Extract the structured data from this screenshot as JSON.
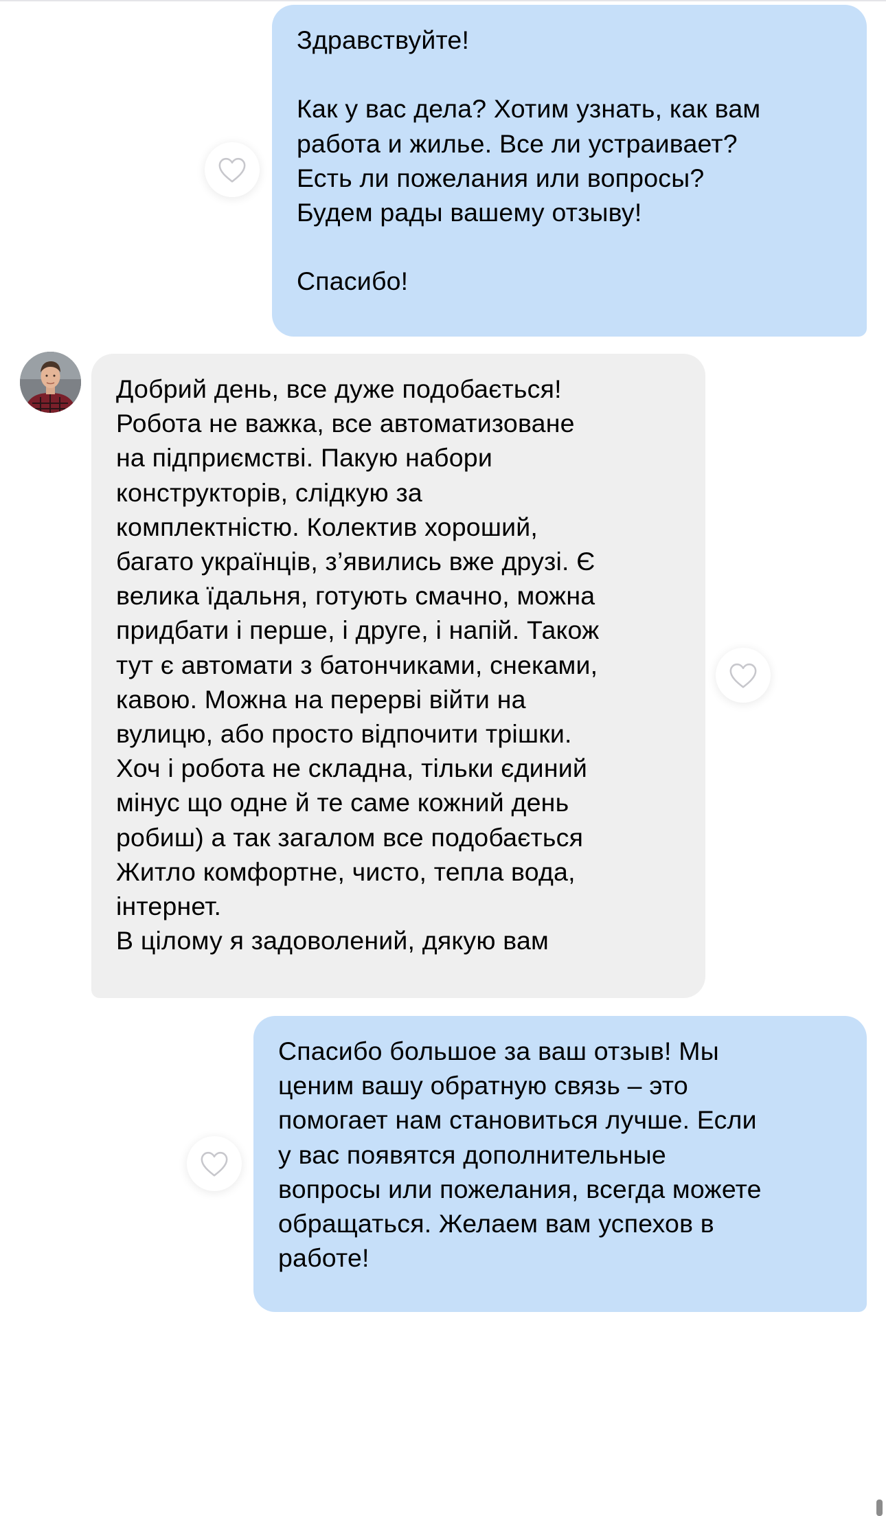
{
  "chat": {
    "messages": [
      {
        "direction": "outgoing",
        "text": "Здравствуйте!\n\nКак у вас дела? Хотим узнать, как вам\nработа и жилье. Все ли устраивает?\nЕсть ли пожелания или вопросы?\nБудем рады вашему отзыву!\n\nСпасибо!",
        "like_icon": "heart-outline-icon"
      },
      {
        "direction": "incoming",
        "avatar": "user-avatar",
        "text": "Добрий день, все дуже подобається!\nРобота не важка, все автоматизоване\nна підприємстві. Пакую набори\nконструкторів, слідкую за\nкомплектністю. Колектив хороший,\nбагато українців, з’явились вже друзі. Є\nвелика їдальня, готують смачно, можна\nпридбати і перше, і друге, і напій. Також\nтут є автомати з батончиками, снеками,\nкавою. Можна на перерві війти на\nвулицю, або просто відпочити трішки.\nХоч і робота не складна, тільки єдиний\nмінус що одне й те саме кожний день\nробиш) а так загалом все подобається\nЖитло комфортне, чисто, тепла вода,\nінтернет.\nВ цілому   я задоволений, дякую вам",
        "like_icon": "heart-outline-icon"
      },
      {
        "direction": "outgoing",
        "text": "Спасибо большое за ваш отзыв! Мы\nценим вашу обратную связь – это\nпомогает нам становиться лучше. Если\nу вас появятся дополнительные\nвопросы или пожелания, всегда можете\nобращаться. Желаем вам успехов в\nработе!",
        "like_icon": "heart-outline-icon"
      }
    ]
  },
  "colors": {
    "outgoing_bubble": "#c6dff9",
    "incoming_bubble": "#efefef",
    "background": "#ffffff",
    "like_stroke": "#c7c7cc"
  }
}
